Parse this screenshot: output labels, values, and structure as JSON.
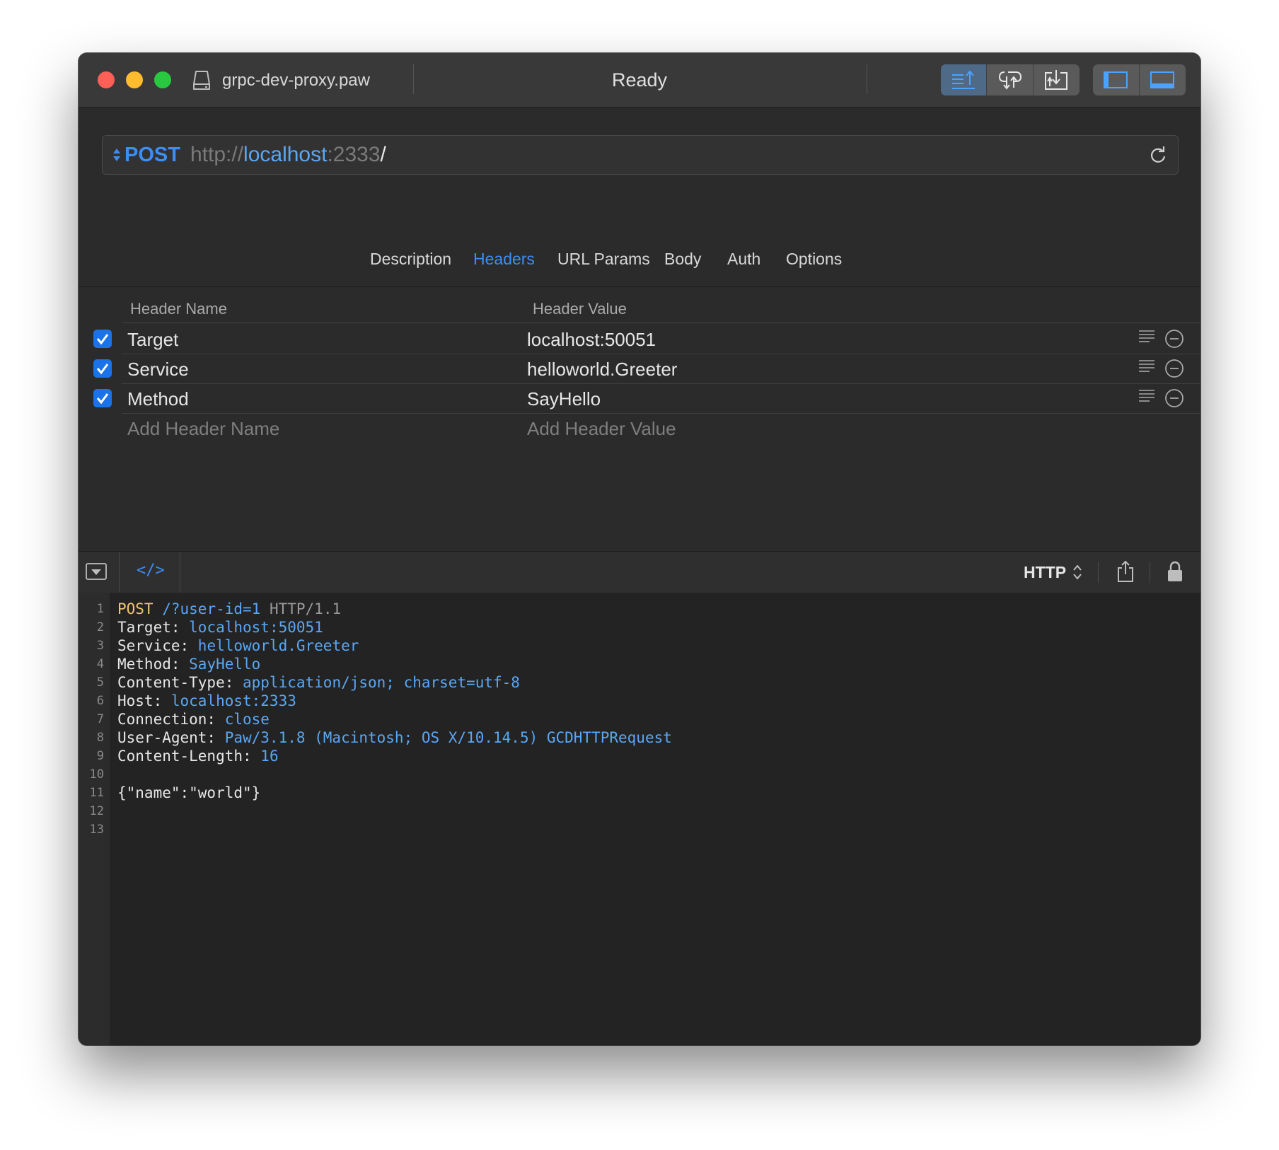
{
  "window": {
    "document_name": "grpc-dev-proxy.paw",
    "status": "Ready"
  },
  "request": {
    "method": "POST",
    "url": {
      "scheme": "http://",
      "host": "localhost",
      "port": ":2333",
      "path": "/"
    }
  },
  "tabs": [
    {
      "label": "Description",
      "active": false
    },
    {
      "label": "Headers",
      "active": true
    },
    {
      "label": "URL Params",
      "active": false
    },
    {
      "label": "Body",
      "active": false
    },
    {
      "label": "Auth",
      "active": false
    },
    {
      "label": "Options",
      "active": false
    }
  ],
  "headers_table": {
    "col_name": "Header Name",
    "col_value": "Header Value",
    "rows": [
      {
        "enabled": true,
        "name": "Target",
        "value": "localhost:50051"
      },
      {
        "enabled": true,
        "name": "Service",
        "value": "helloworld.Greeter"
      },
      {
        "enabled": true,
        "name": "Method",
        "value": "SayHello"
      }
    ],
    "add_name_placeholder": "Add Header Name",
    "add_value_placeholder": "Add Header Value"
  },
  "preview_toolbar": {
    "code_toggle": "</>",
    "format": "HTTP"
  },
  "code_lines": [
    {
      "n": "1",
      "parts": [
        [
          "c-method",
          "POST"
        ],
        [
          "c-key",
          " "
        ],
        [
          "c-path",
          "/?user-id=1"
        ],
        [
          "c-key",
          " "
        ],
        [
          "c-proto",
          "HTTP/1.1"
        ]
      ]
    },
    {
      "n": "2",
      "parts": [
        [
          "c-key",
          "Target: "
        ],
        [
          "c-val",
          "localhost:50051"
        ]
      ]
    },
    {
      "n": "3",
      "parts": [
        [
          "c-key",
          "Service: "
        ],
        [
          "c-val",
          "helloworld.Greeter"
        ]
      ]
    },
    {
      "n": "4",
      "parts": [
        [
          "c-key",
          "Method: "
        ],
        [
          "c-val",
          "SayHello"
        ]
      ]
    },
    {
      "n": "5",
      "parts": [
        [
          "c-key",
          "Content-Type: "
        ],
        [
          "c-val",
          "application/json; charset=utf-8"
        ]
      ]
    },
    {
      "n": "6",
      "parts": [
        [
          "c-key",
          "Host: "
        ],
        [
          "c-val",
          "localhost:2333"
        ]
      ]
    },
    {
      "n": "7",
      "parts": [
        [
          "c-key",
          "Connection: "
        ],
        [
          "c-val",
          "close"
        ]
      ]
    },
    {
      "n": "8",
      "parts": [
        [
          "c-key",
          "User-Agent: "
        ],
        [
          "c-val",
          "Paw/3.1.8 (Macintosh; OS X/10.14.5) GCDHTTPRequest"
        ]
      ]
    },
    {
      "n": "9",
      "parts": [
        [
          "c-key",
          "Content-Length: "
        ],
        [
          "c-val",
          "16"
        ]
      ]
    },
    {
      "n": "10",
      "parts": []
    },
    {
      "n": "11",
      "parts": [
        [
          "c-key",
          "{\"name\":\"world\"}"
        ]
      ]
    },
    {
      "n": "12",
      "parts": []
    },
    {
      "n": "13",
      "parts": []
    }
  ],
  "colors": {
    "accent": "#3b8ef5",
    "code_value": "#5aa7f5",
    "code_method": "#f0c674"
  },
  "icons": {
    "document": "document-icon",
    "send_request": "send-request-icon",
    "view_toggle": "view-toggle-icon",
    "import": "import-icon",
    "sidebar": "sidebar-icon",
    "bottom_panel": "bottom-panel-icon",
    "refresh": "refresh-icon",
    "share": "share-icon",
    "lock": "lock-icon"
  }
}
